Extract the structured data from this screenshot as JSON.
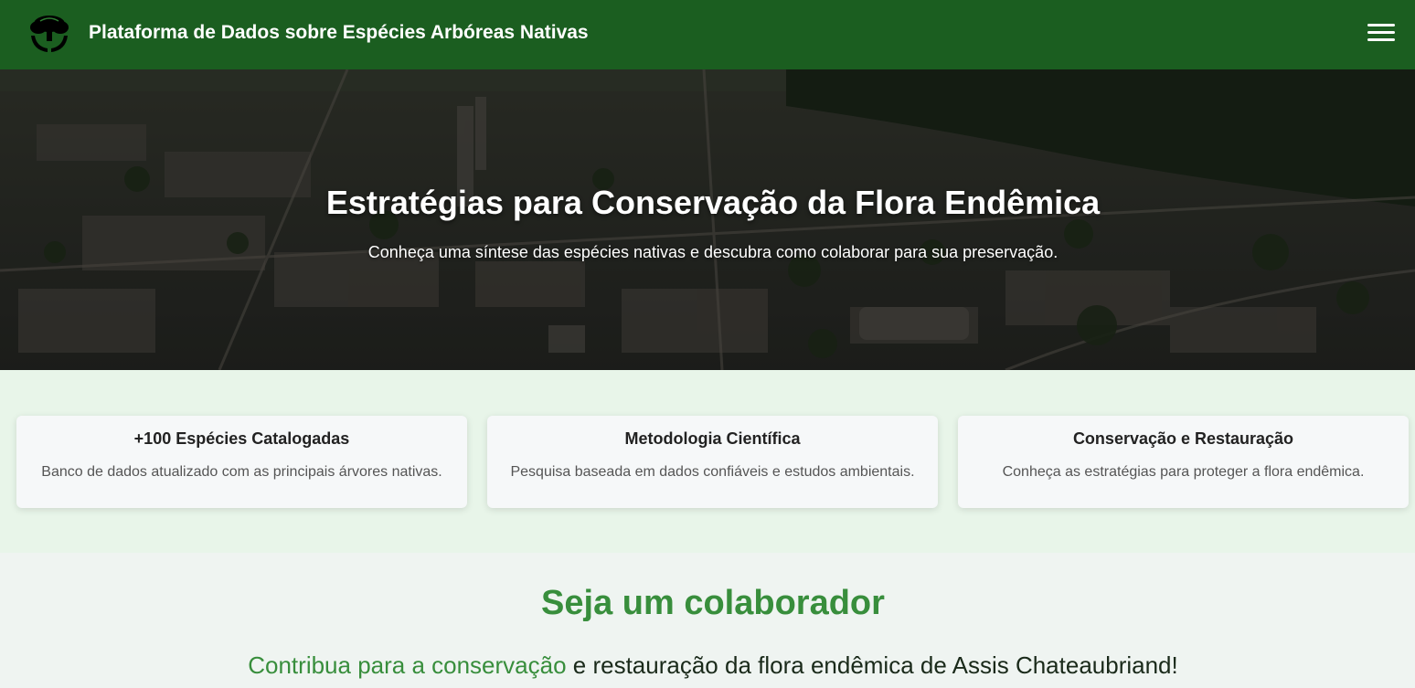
{
  "header": {
    "title": "Plataforma de Dados sobre Espécies Arbóreas Nativas",
    "logo_icon": "tree-hands-icon",
    "menu_icon": "hamburger-menu-icon",
    "background_color": "#1b5e20"
  },
  "hero": {
    "title": "Estratégias para Conservação da Flora Endêmica",
    "subtitle": "Conheça uma síntese das espécies nativas e descubra como colaborar para sua preservação."
  },
  "features": [
    {
      "title": "+100 Espécies Catalogadas",
      "description": "Banco de dados atualizado com as principais árvores nativas."
    },
    {
      "title": "Metodologia Científica",
      "description": "Pesquisa baseada em dados confiáveis e estudos ambientais."
    },
    {
      "title": "Conservação e Restauração",
      "description": "Conheça as estratégias para proteger a flora endêmica."
    }
  ],
  "collaborator": {
    "title": "Seja um colaborador",
    "text_link": "Contribua para a conservação",
    "text_rest": " e restauração da flora endêmica de Assis Chateaubriand!",
    "accent_color": "#388e3c"
  }
}
